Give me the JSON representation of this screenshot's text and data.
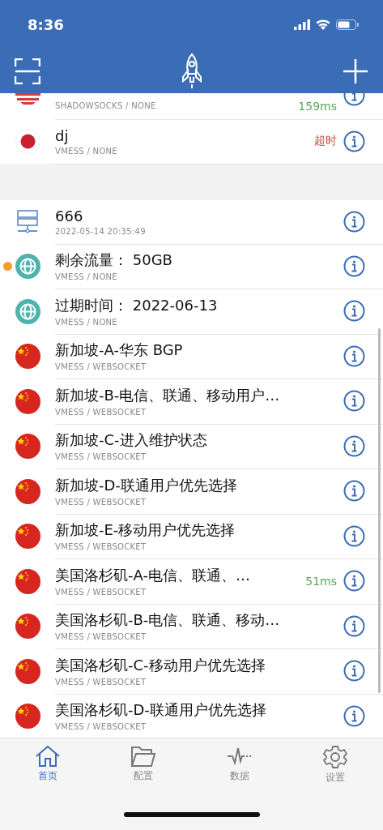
{
  "status_bar": {
    "time": "8:36"
  },
  "groups": [
    {
      "rows": [
        {
          "kind": "us",
          "subtitle": "SHADOWSOCKS / NONE",
          "latency": {
            "text": "159ms",
            "color": "#5aa85a"
          },
          "selected": false
        },
        {
          "kind": "jp",
          "title": "dj",
          "subtitle": "VMESS / NONE",
          "latency": {
            "text": "超时",
            "color": "#c64b3c"
          },
          "selected": false
        }
      ]
    },
    {
      "header": {
        "title": "666",
        "subtitle": "2022-05-14 20:35:49"
      },
      "rows": [
        {
          "kind": "globe",
          "title": "剩余流量： 50GB",
          "subtitle": "VMESS / NONE",
          "selected": true
        },
        {
          "kind": "globe",
          "title": "过期时间： 2022-06-13",
          "subtitle": "VMESS / NONE",
          "selected": false
        },
        {
          "kind": "cn",
          "title": "新加坡-A-华东 BGP",
          "subtitle": "VMESS / WEBSOCKET",
          "selected": false
        },
        {
          "kind": "cn",
          "title": "新加坡-B-电信、联通、移动用户…",
          "subtitle": "VMESS / WEBSOCKET",
          "selected": false
        },
        {
          "kind": "cn",
          "title": "新加坡-C-进入维护状态",
          "subtitle": "VMESS / WEBSOCKET",
          "selected": false
        },
        {
          "kind": "cn",
          "title": "新加坡-D-联通用户优先选择",
          "subtitle": "VMESS / WEBSOCKET",
          "selected": false
        },
        {
          "kind": "cn",
          "title": "新加坡-E-移动用户优先选择",
          "subtitle": "VMESS / WEBSOCKET",
          "selected": false
        },
        {
          "kind": "cn",
          "title": "美国洛杉矶-A-电信、联通、…",
          "subtitle": "VMESS / WEBSOCKET",
          "latency": {
            "text": "51ms",
            "color": "#5aa85a"
          },
          "selected": false
        },
        {
          "kind": "cn",
          "title": "美国洛杉矶-B-电信、联通、移动…",
          "subtitle": "VMESS / WEBSOCKET",
          "selected": false
        },
        {
          "kind": "cn",
          "title": "美国洛杉矶-C-移动用户优先选择",
          "subtitle": "VMESS / WEBSOCKET",
          "selected": false
        },
        {
          "kind": "cn",
          "title": "美国洛杉矶-D-联通用户优先选择",
          "subtitle": "VMESS / WEBSOCKET",
          "selected": false
        }
      ]
    }
  ],
  "tabs": [
    {
      "kind": "home",
      "label": "首页",
      "selected": true
    },
    {
      "kind": "folder",
      "label": "配置",
      "selected": false
    },
    {
      "kind": "pulse",
      "label": "数据",
      "selected": false
    },
    {
      "kind": "gear",
      "label": "设置",
      "selected": false
    }
  ]
}
